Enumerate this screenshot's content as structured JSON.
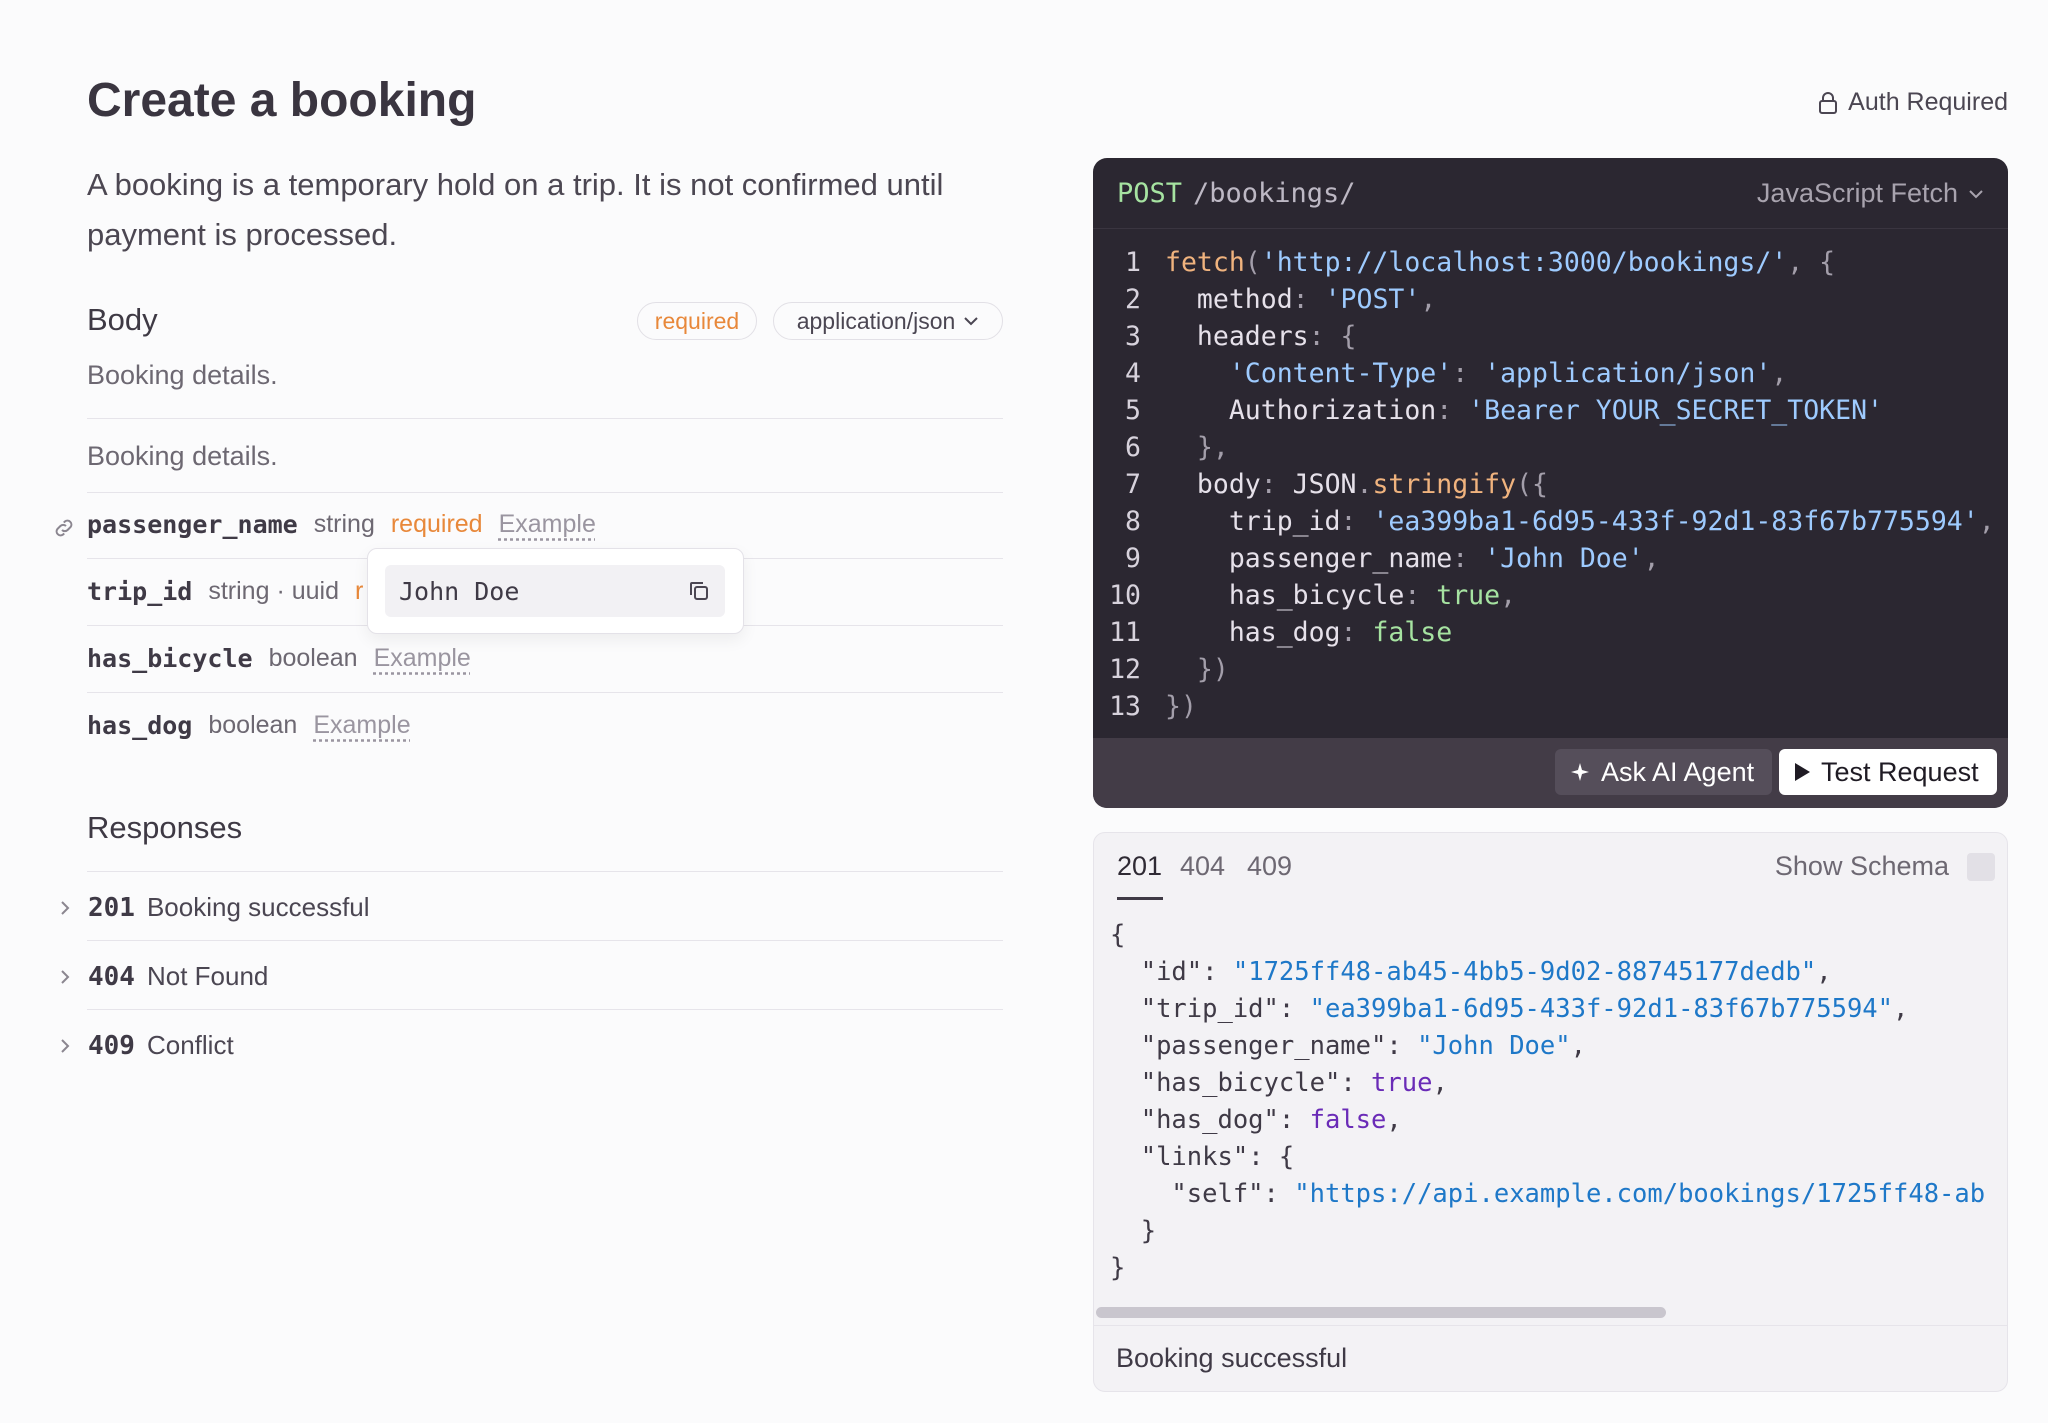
{
  "header": {
    "title": "Create a booking",
    "auth_label": "Auth Required",
    "description": "A booking is a temporary hold on a trip. It is not confirmed until payment is processed."
  },
  "body_section": {
    "heading": "Body",
    "required_badge": "required",
    "content_type": "application/json",
    "description": "Booking details.",
    "schema_description": "Booking details.",
    "properties": [
      {
        "name": "passenger_name",
        "type": "string",
        "required": "required",
        "example": "Example"
      },
      {
        "name": "trip_id",
        "type": "string · uuid",
        "required": "r"
      },
      {
        "name": "has_bicycle",
        "type": "boolean",
        "example": "Example"
      },
      {
        "name": "has_dog",
        "type": "boolean",
        "example": "Example"
      }
    ],
    "tooltip_value": "John Doe"
  },
  "responses": {
    "heading": "Responses",
    "items": [
      {
        "code": "201",
        "label": "Booking successful"
      },
      {
        "code": "404",
        "label": "Not Found"
      },
      {
        "code": "409",
        "label": "Conflict"
      }
    ]
  },
  "code_panel": {
    "method": "POST",
    "path": "/bookings/",
    "language": "JavaScript Fetch",
    "ask_ai_label": "Ask AI Agent",
    "test_request_label": "Test Request",
    "line_numbers": [
      "1",
      "2",
      "3",
      "4",
      "5",
      "6",
      "7",
      "8",
      "9",
      "10",
      "11",
      "12",
      "13"
    ],
    "tokens": {
      "fetch": "fetch",
      "url": "'http://localhost:3000/bookings/'",
      "method_key": "method",
      "method_val": "'POST'",
      "headers_key": "headers",
      "ct_key": "'Content-Type'",
      "ct_val": "'application/json'",
      "auth_key": "Authorization",
      "auth_val": "'Bearer YOUR_SECRET_TOKEN'",
      "body_key": "body",
      "json_obj": "JSON",
      "stringify": "stringify",
      "trip_key": "trip_id",
      "trip_val": "'ea399ba1-6d95-433f-92d1-83f67b775594'",
      "pname_key": "passenger_name",
      "pname_val": "'John Doe'",
      "bike_key": "has_bicycle",
      "bike_val": "true",
      "dog_key": "has_dog",
      "dog_val": "false"
    }
  },
  "response_panel": {
    "tabs": [
      "201",
      "404",
      "409"
    ],
    "show_schema_label": "Show Schema",
    "json": {
      "id_key": "\"id\"",
      "id_val": "\"1725ff48-ab45-4bb5-9d02-88745177dedb\"",
      "trip_key": "\"trip_id\"",
      "trip_val": "\"ea399ba1-6d95-433f-92d1-83f67b775594\"",
      "pname_key": "\"passenger_name\"",
      "pname_val": "\"John Doe\"",
      "bike_key": "\"has_bicycle\"",
      "bike_val": "true",
      "dog_key": "\"has_dog\"",
      "dog_val": "false",
      "links_key": "\"links\"",
      "self_key": "\"self\"",
      "self_val": "\"https://api.example.com/bookings/1725ff48-ab"
    },
    "footer_label": "Booking successful"
  }
}
